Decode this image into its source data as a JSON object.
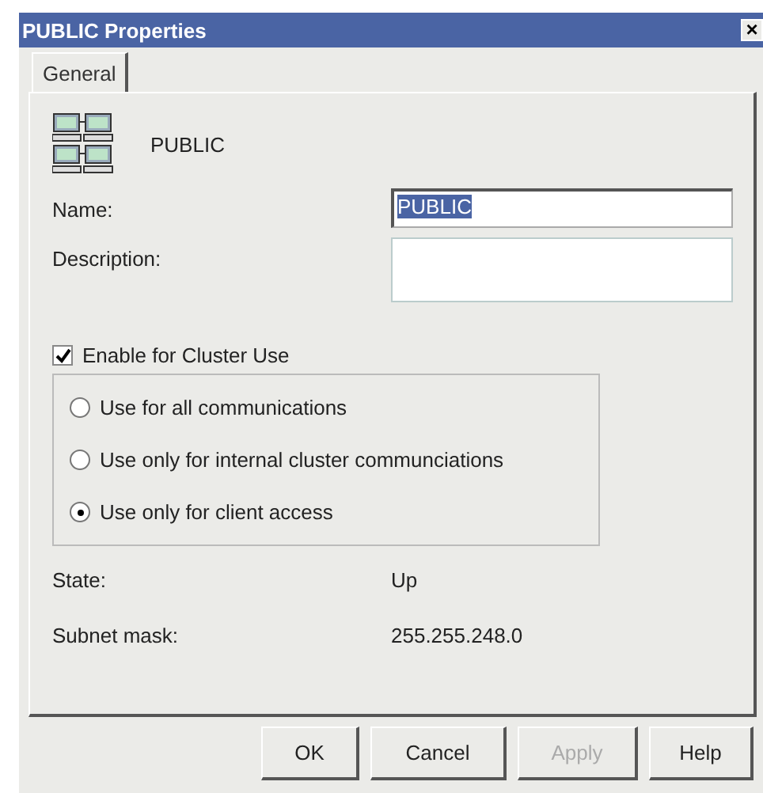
{
  "window": {
    "title": "PUBLIC Properties",
    "close": "×"
  },
  "tabs": [
    {
      "label": "General",
      "selected": true
    }
  ],
  "network": {
    "name": "PUBLIC"
  },
  "fields": [
    {
      "label": "Name:",
      "value": "PUBLIC",
      "selected_text": true,
      "kind": "single"
    },
    {
      "label": "Description:",
      "kind": "multi"
    }
  ],
  "enable_cluster": {
    "label": "Enable for Cluster Use",
    "checked": true
  },
  "options": [
    {
      "label": "Use for all communications",
      "selected": false
    },
    {
      "label": "Use only for internal cluster communciations",
      "selected": false
    },
    {
      "label": "Use only for client access",
      "selected": true
    }
  ],
  "info": [
    {
      "label": "State:",
      "value": "Up"
    },
    {
      "label": "Subnet mask:",
      "value": "255.255.248.0"
    }
  ],
  "buttons": [
    {
      "label": "OK",
      "disabled": false
    },
    {
      "label": "Cancel",
      "disabled": false
    },
    {
      "label": "Apply",
      "disabled": true
    },
    {
      "label": "Help",
      "disabled": false
    }
  ]
}
